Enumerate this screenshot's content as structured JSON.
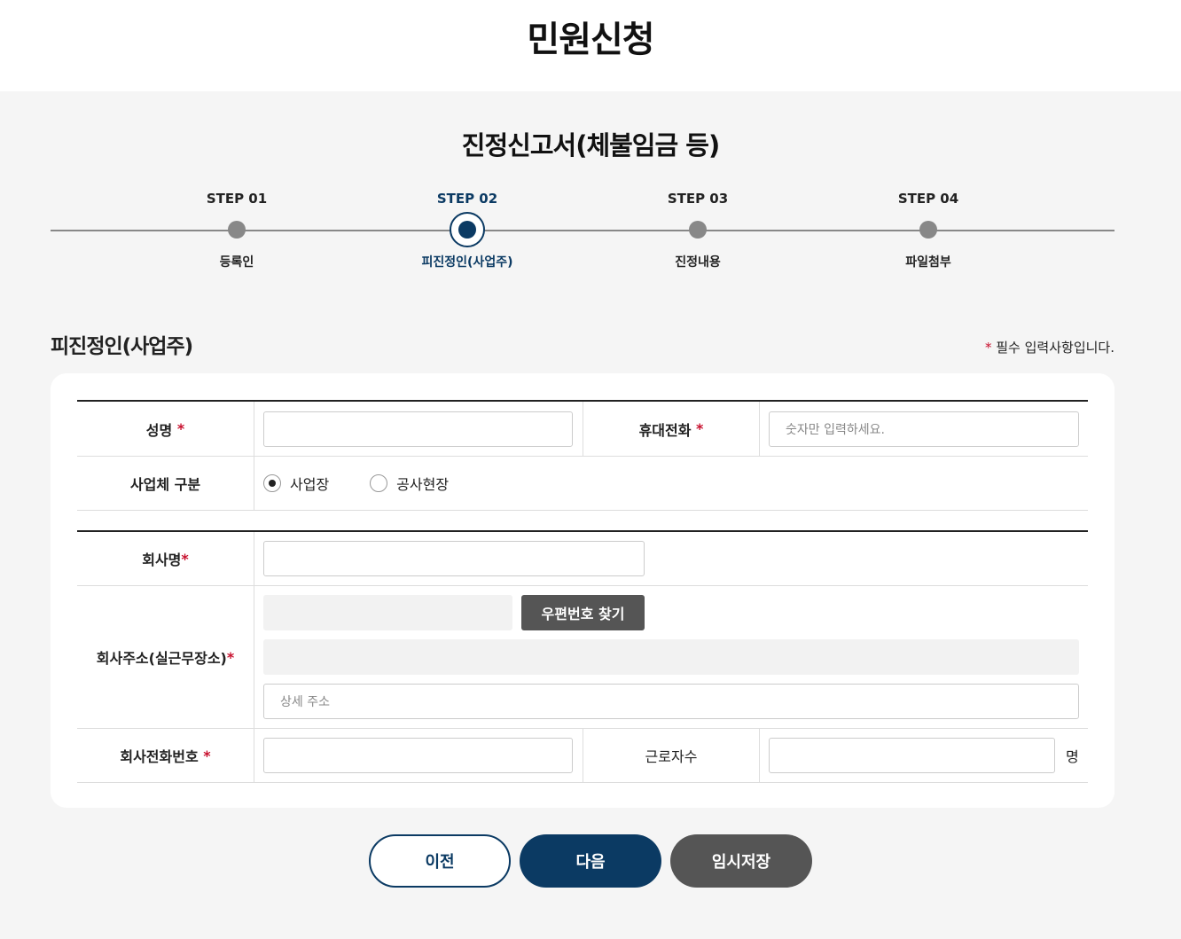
{
  "page_title": "민원신청",
  "form_title": "진정신고서(체불임금 등)",
  "steps": [
    {
      "label": "STEP 01",
      "name": "등록인"
    },
    {
      "label": "STEP 02",
      "name": "피진정인(사업주)"
    },
    {
      "label": "STEP 03",
      "name": "진정내용"
    },
    {
      "label": "STEP 04",
      "name": "파일첨부"
    }
  ],
  "active_step": 2,
  "section": {
    "title": "피진정인(사업주)",
    "required_mark": "*",
    "required_note": "필수 입력사항입니다."
  },
  "fields": {
    "name_label": "성명",
    "phone_label": "휴대전화",
    "phone_placeholder": "숫자만 입력하세요.",
    "biz_type_label": "사업체 구분",
    "biz_type_options": [
      "사업장",
      "공사현장"
    ],
    "biz_type_selected": "사업장",
    "company_label": "회사명",
    "address_label": "회사주소(실근무장소)",
    "zip_button": "우편번호 찾기",
    "address_detail_placeholder": "상세 주소",
    "company_phone_label": "회사전화번호",
    "workers_label": "근로자수",
    "workers_unit": "명"
  },
  "buttons": {
    "prev": "이전",
    "next": "다음",
    "save": "임시저장"
  },
  "colors": {
    "primary": "#0b3a63",
    "required": "#c8102e",
    "secondary_button": "#555555",
    "background": "#f5f5f5"
  }
}
